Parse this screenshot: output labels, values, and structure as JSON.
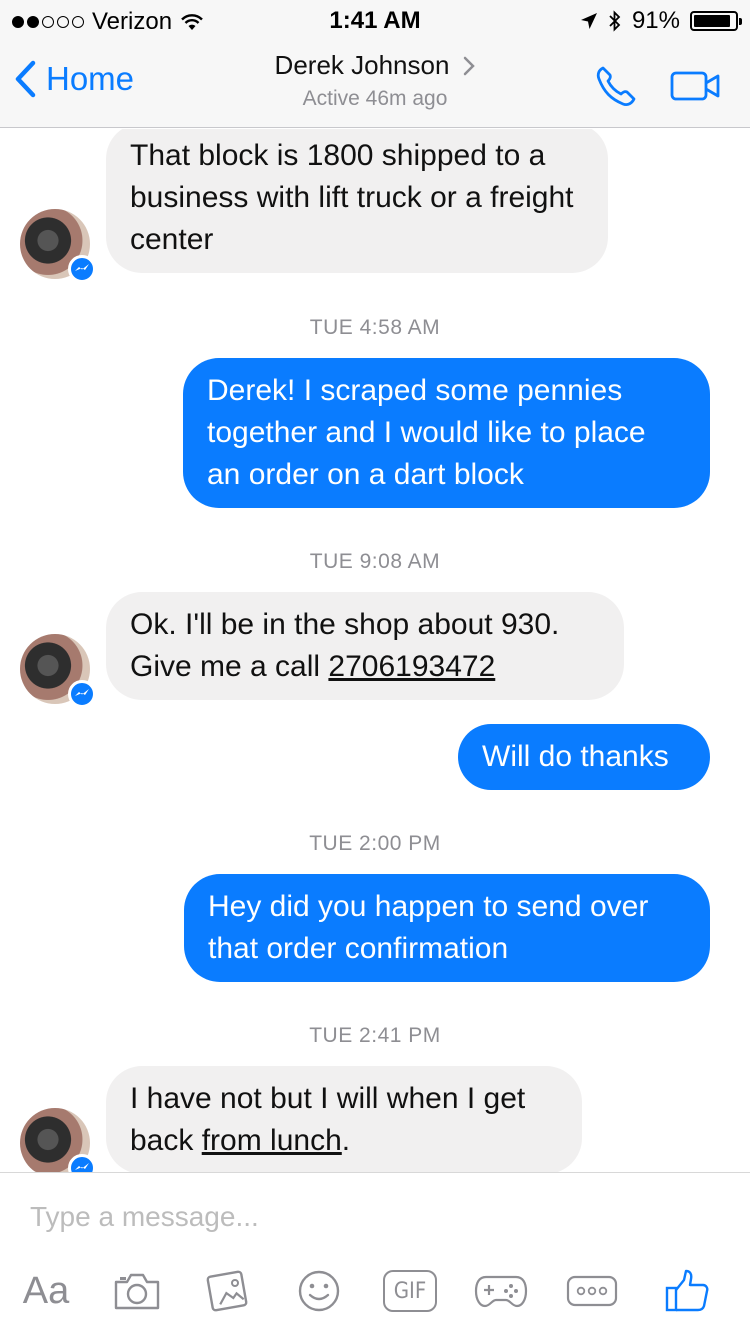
{
  "status_bar": {
    "carrier": "Verizon",
    "time": "1:41 AM",
    "battery": "91%",
    "battery_level": 0.91
  },
  "nav": {
    "back_label": "Home",
    "title": "Derek Johnson",
    "subtitle": "Active 46m ago",
    "accent_color": "#0a7cff"
  },
  "messages": [
    {
      "from": "them",
      "text": "That block is 1800 shipped to a business with lift truck or a freight center"
    },
    {
      "timestamp": "TUE 4:58 AM"
    },
    {
      "from": "me",
      "text": "Derek! I scraped some pennies together and I would like to place an order on a dart block"
    },
    {
      "timestamp": "TUE 9:08 AM"
    },
    {
      "from": "them",
      "text_before_link": "Ok. I'll be in the shop about 930. Give me a call ",
      "link": "2706193472"
    },
    {
      "from": "me",
      "text": "Will do thanks"
    },
    {
      "timestamp": "TUE 2:00 PM"
    },
    {
      "from": "me",
      "text": "Hey did you happen to send over that order confirmation"
    },
    {
      "timestamp": "TUE 2:41 PM"
    },
    {
      "from": "them",
      "text_before_link": "I have not but I will when I get back ",
      "link": "from lunch",
      "text_after_link": "."
    }
  ],
  "composer": {
    "placeholder": "Type a message...",
    "aa_label": "Aa",
    "gif_label": "GIF"
  },
  "icons": {
    "back": "chevron-left-icon",
    "disclosure": "chevron-right-icon",
    "call": "phone-icon",
    "video": "video-camera-icon",
    "camera": "camera-icon",
    "gallery": "photo-icon",
    "emoji": "smiley-icon",
    "games": "gamepad-icon",
    "more": "more-icon",
    "like": "thumbs-up-icon"
  }
}
